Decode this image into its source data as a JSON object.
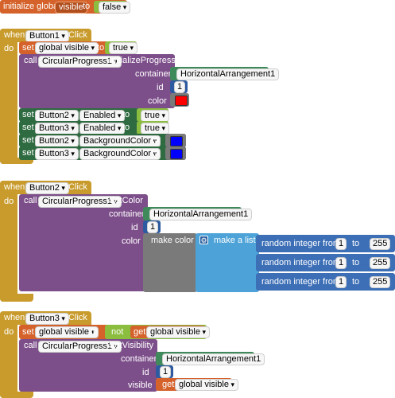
{
  "init": {
    "initialize_global": "initialize global",
    "var_name": "visible",
    "to": "to",
    "value": "false"
  },
  "common": {
    "when": "when",
    "do": "do",
    "event_click": ".Click",
    "call": "call",
    "set": "set",
    "get": "get",
    "to": "to"
  },
  "block1": {
    "button": "Button1",
    "set_var": "global visible",
    "set_value": "true",
    "component": "CircularProgress1",
    "method": ".InitializeProgress",
    "param_container": "container",
    "container_value": "HorizontalArrangement1",
    "param_id": "id",
    "id_value": "1",
    "param_color": "color",
    "color_value": "#ff0000",
    "setters": [
      {
        "component": "Button2",
        "property": "Enabled",
        "value": "true"
      },
      {
        "component": "Button3",
        "property": "Enabled",
        "value": "true"
      },
      {
        "component": "Button2",
        "property": "BackgroundColor",
        "color": "#0000ff"
      },
      {
        "component": "Button3",
        "property": "BackgroundColor",
        "color": "#0000ff"
      }
    ]
  },
  "block2": {
    "button": "Button2",
    "component": "CircularProgress1",
    "method": ".SetColor",
    "param_container": "container",
    "container_value": "HorizontalArrangement1",
    "param_id": "id",
    "id_value": "1",
    "param_color": "color",
    "make_color": "make color",
    "make_list": "make a list",
    "random_label": "random integer from",
    "random_to": "to",
    "randoms": [
      {
        "from": "1",
        "to": "255"
      },
      {
        "from": "1",
        "to": "255"
      },
      {
        "from": "1",
        "to": "255"
      }
    ]
  },
  "block3": {
    "button": "Button3",
    "set_var": "global visible",
    "not_label": "not",
    "get_var": "global visible",
    "component": "CircularProgress1",
    "method": ".SetVisibility",
    "param_container": "container",
    "container_value": "HorizontalArrangement1",
    "param_id": "id",
    "id_value": "1",
    "param_visible": "visible",
    "visible_get": "global visible"
  }
}
